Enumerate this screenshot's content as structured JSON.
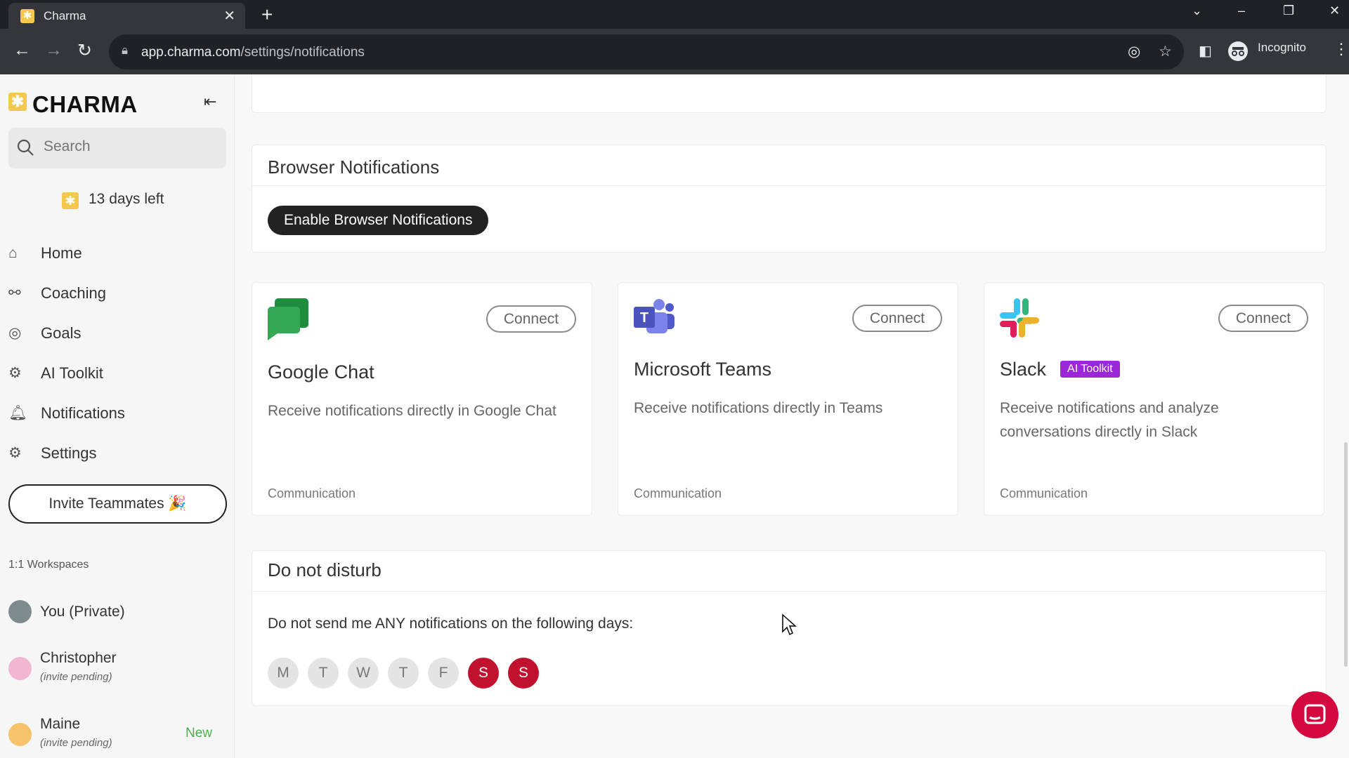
{
  "browser": {
    "tab_title": "Charma",
    "url_host": "app.charma.com",
    "url_path": "/settings/notifications",
    "profile_label": "Incognito"
  },
  "sidebar": {
    "logo_text": "CHARMA",
    "search_placeholder": "Search",
    "trial_text": "13 days left",
    "nav": [
      {
        "label": "Home",
        "icon": "home-icon"
      },
      {
        "label": "Coaching",
        "icon": "coaching-icon"
      },
      {
        "label": "Goals",
        "icon": "goals-icon"
      },
      {
        "label": "AI Toolkit",
        "icon": "robot-icon"
      },
      {
        "label": "Notifications",
        "icon": "bell-icon"
      },
      {
        "label": "Settings",
        "icon": "gear-icon"
      }
    ],
    "invite_label": "Invite Teammates 🎉",
    "workspaces_heading": "1:1 Workspaces",
    "workspaces": [
      {
        "name": "You (Private)",
        "sub": ""
      },
      {
        "name": "Christopher",
        "sub": "(invite pending)"
      },
      {
        "name": "Maine",
        "sub": "(invite pending)",
        "badge": "New"
      }
    ]
  },
  "main": {
    "browser_notifications": {
      "title": "Browser Notifications",
      "button": "Enable Browser Notifications"
    },
    "integrations": [
      {
        "name": "Google Chat",
        "description": "Receive notifications directly in Google Chat",
        "category": "Communication",
        "button": "Connect",
        "badge": ""
      },
      {
        "name": "Microsoft Teams",
        "description": "Receive notifications directly in Teams",
        "category": "Communication",
        "button": "Connect",
        "badge": ""
      },
      {
        "name": "Slack",
        "description": "Receive notifications and analyze conversations directly in Slack",
        "category": "Communication",
        "button": "Connect",
        "badge": "AI Toolkit"
      }
    ],
    "dnd": {
      "title": "Do not disturb",
      "text": "Do not send me ANY notifications on the following days:",
      "days": [
        {
          "label": "M",
          "selected": false
        },
        {
          "label": "T",
          "selected": false
        },
        {
          "label": "W",
          "selected": false
        },
        {
          "label": "T",
          "selected": false
        },
        {
          "label": "F",
          "selected": false
        },
        {
          "label": "S",
          "selected": true
        },
        {
          "label": "S",
          "selected": true
        }
      ]
    }
  },
  "colors": {
    "accent_red": "#c0122e",
    "brand_yellow": "#f2c94c",
    "badge_purple": "#9c27d9",
    "fab_red": "#d4083f"
  }
}
